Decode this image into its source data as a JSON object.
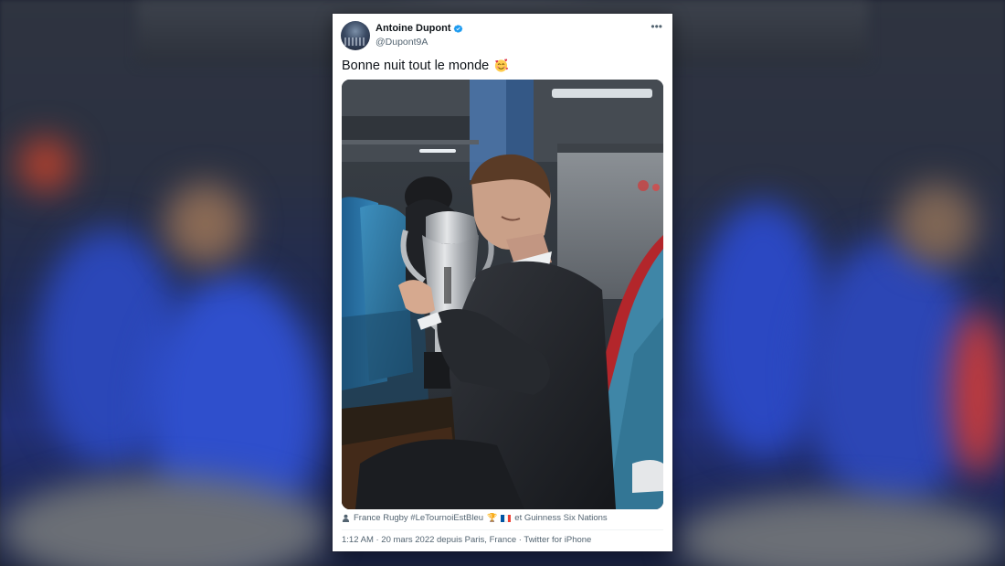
{
  "tweet": {
    "author_name": "Antoine Dupont",
    "author_handle": "@Dupont9A",
    "text": "Bonne nuit tout le monde",
    "text_emoji": "smiling-face-with-hearts-icon",
    "tags_prefix": "France Rugby #LeTournoiEstBleu",
    "tags_suffix": "et Guinness Six Nations",
    "meta_line": "1:12 AM · 20 mars 2022 depuis Paris, France · Twitter for iPhone",
    "verified": true
  },
  "icons": {
    "more": "more-icon",
    "verified": "verified-badge-icon",
    "person": "person-icon",
    "trophy": "trophy-icon",
    "flag": "france-flag-icon"
  },
  "colors": {
    "verified_blue": "#1d9bf0",
    "text_primary": "#0f1419",
    "text_secondary": "#536471",
    "flag_blue": "#0055a4",
    "flag_white": "#ffffff",
    "flag_red": "#ef4135"
  }
}
